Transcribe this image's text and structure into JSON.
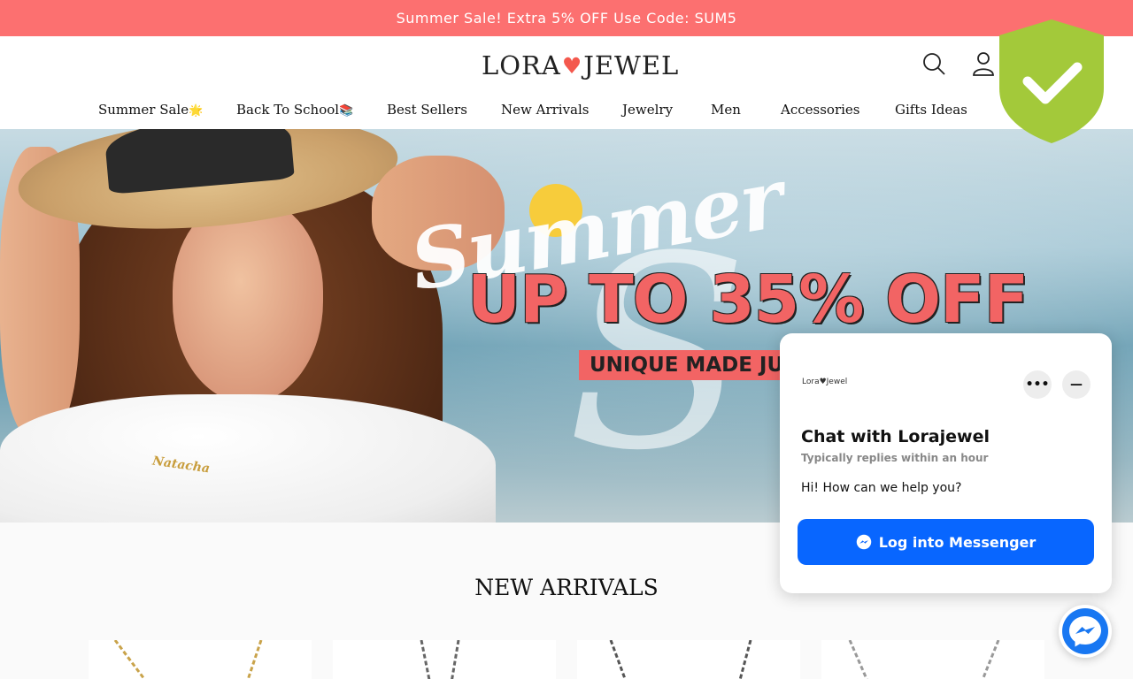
{
  "announcement": {
    "text": "Summer Sale! Extra 5% OFF Use Code: SUM5"
  },
  "header": {
    "logo": {
      "left": "LORA",
      "heart": "♥",
      "right": "JEWEL"
    },
    "icons": [
      "search-icon",
      "account-icon"
    ]
  },
  "nav": {
    "items": [
      {
        "label": "Summer Sale",
        "emoji": "🌟"
      },
      {
        "label": "Back To School",
        "emoji": "📚"
      },
      {
        "label": "Best Sellers"
      },
      {
        "label": "New Arrivals"
      },
      {
        "label": "Jewelry"
      },
      {
        "label": "Men"
      },
      {
        "label": "Accessories"
      },
      {
        "label": "Gifts Ideas"
      }
    ]
  },
  "hero": {
    "summer": "Summer",
    "headline": "UP TO 35% OFF",
    "subline": "UNIQUE MADE JUST",
    "necklace": "Natacha"
  },
  "main": {
    "section_title": "NEW ARRIVALS"
  },
  "chat": {
    "logo": "Lora♥Jewel",
    "more": "•••",
    "minimize": "—",
    "title": "Chat with Lorajewel",
    "subtitle": "Typically replies within an hour",
    "message": "Hi! How can we help you?",
    "cta": "Log into Messenger"
  },
  "colors": {
    "announcement_bg": "#fc7070",
    "accent": "#f26464",
    "messenger": "#0866ff",
    "shield": "#a3c93a"
  }
}
